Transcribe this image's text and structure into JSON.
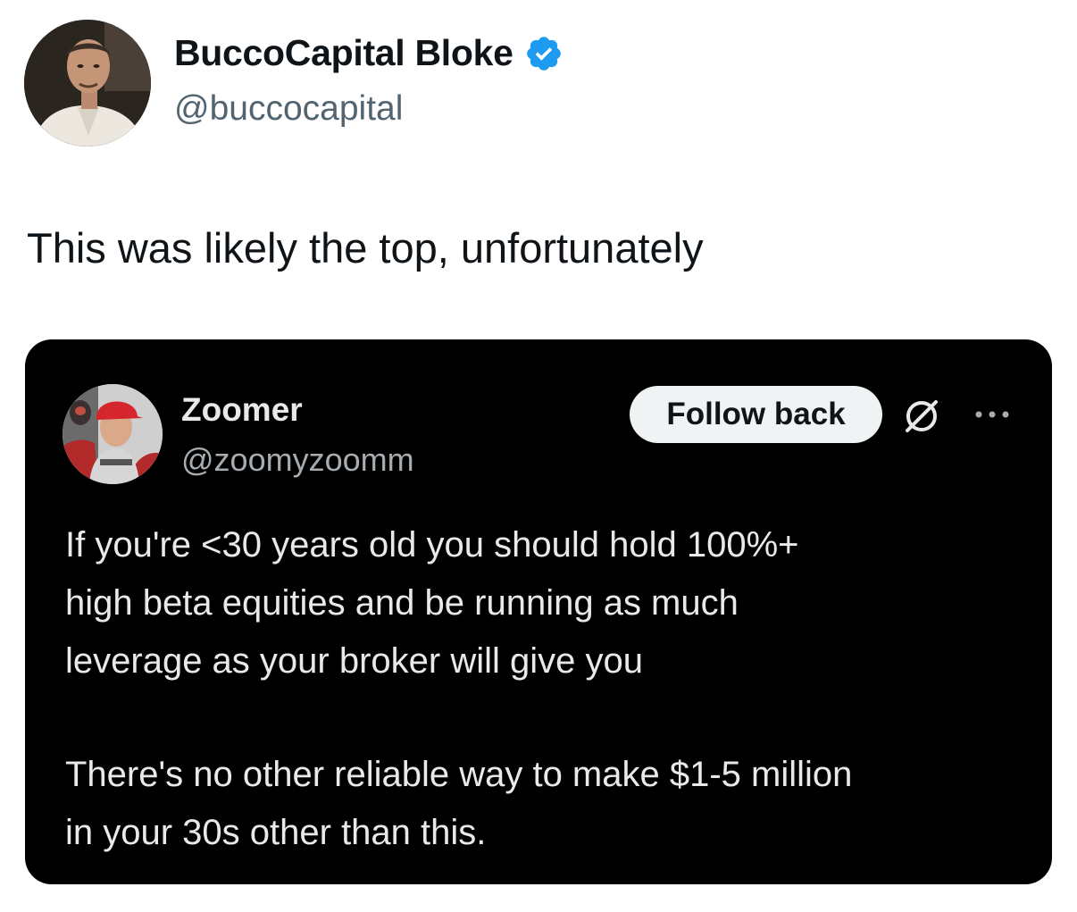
{
  "tweet": {
    "author_name": "BuccoCapital Bloke",
    "author_handle": "@buccocapital",
    "text": "This was likely the top, unfortunately",
    "avatar_icon": "profile-photo-man-chef-jacket",
    "verified_icon": "verified-badge-icon"
  },
  "quoted_tweet": {
    "author_name": "Zoomer",
    "author_handle": "@zoomyzoomm",
    "follow_button_label": "Follow back",
    "avatar_icon": "profile-photo-man-red-cap",
    "grok_icon": "grok-icon",
    "more_icon": "more-options-icon",
    "lines": [
      "If you're <30 years old you should hold 100%+",
      "high beta equities and be running as much",
      "leverage as your broker will give you",
      "There's no other reliable way to make $1-5 million",
      "in your 30s other than this."
    ]
  },
  "colors": {
    "verified_blue": "#1d9bf0",
    "quote_background": "#000000",
    "handle_gray": "#536471",
    "button_background": "#eff3f4"
  }
}
